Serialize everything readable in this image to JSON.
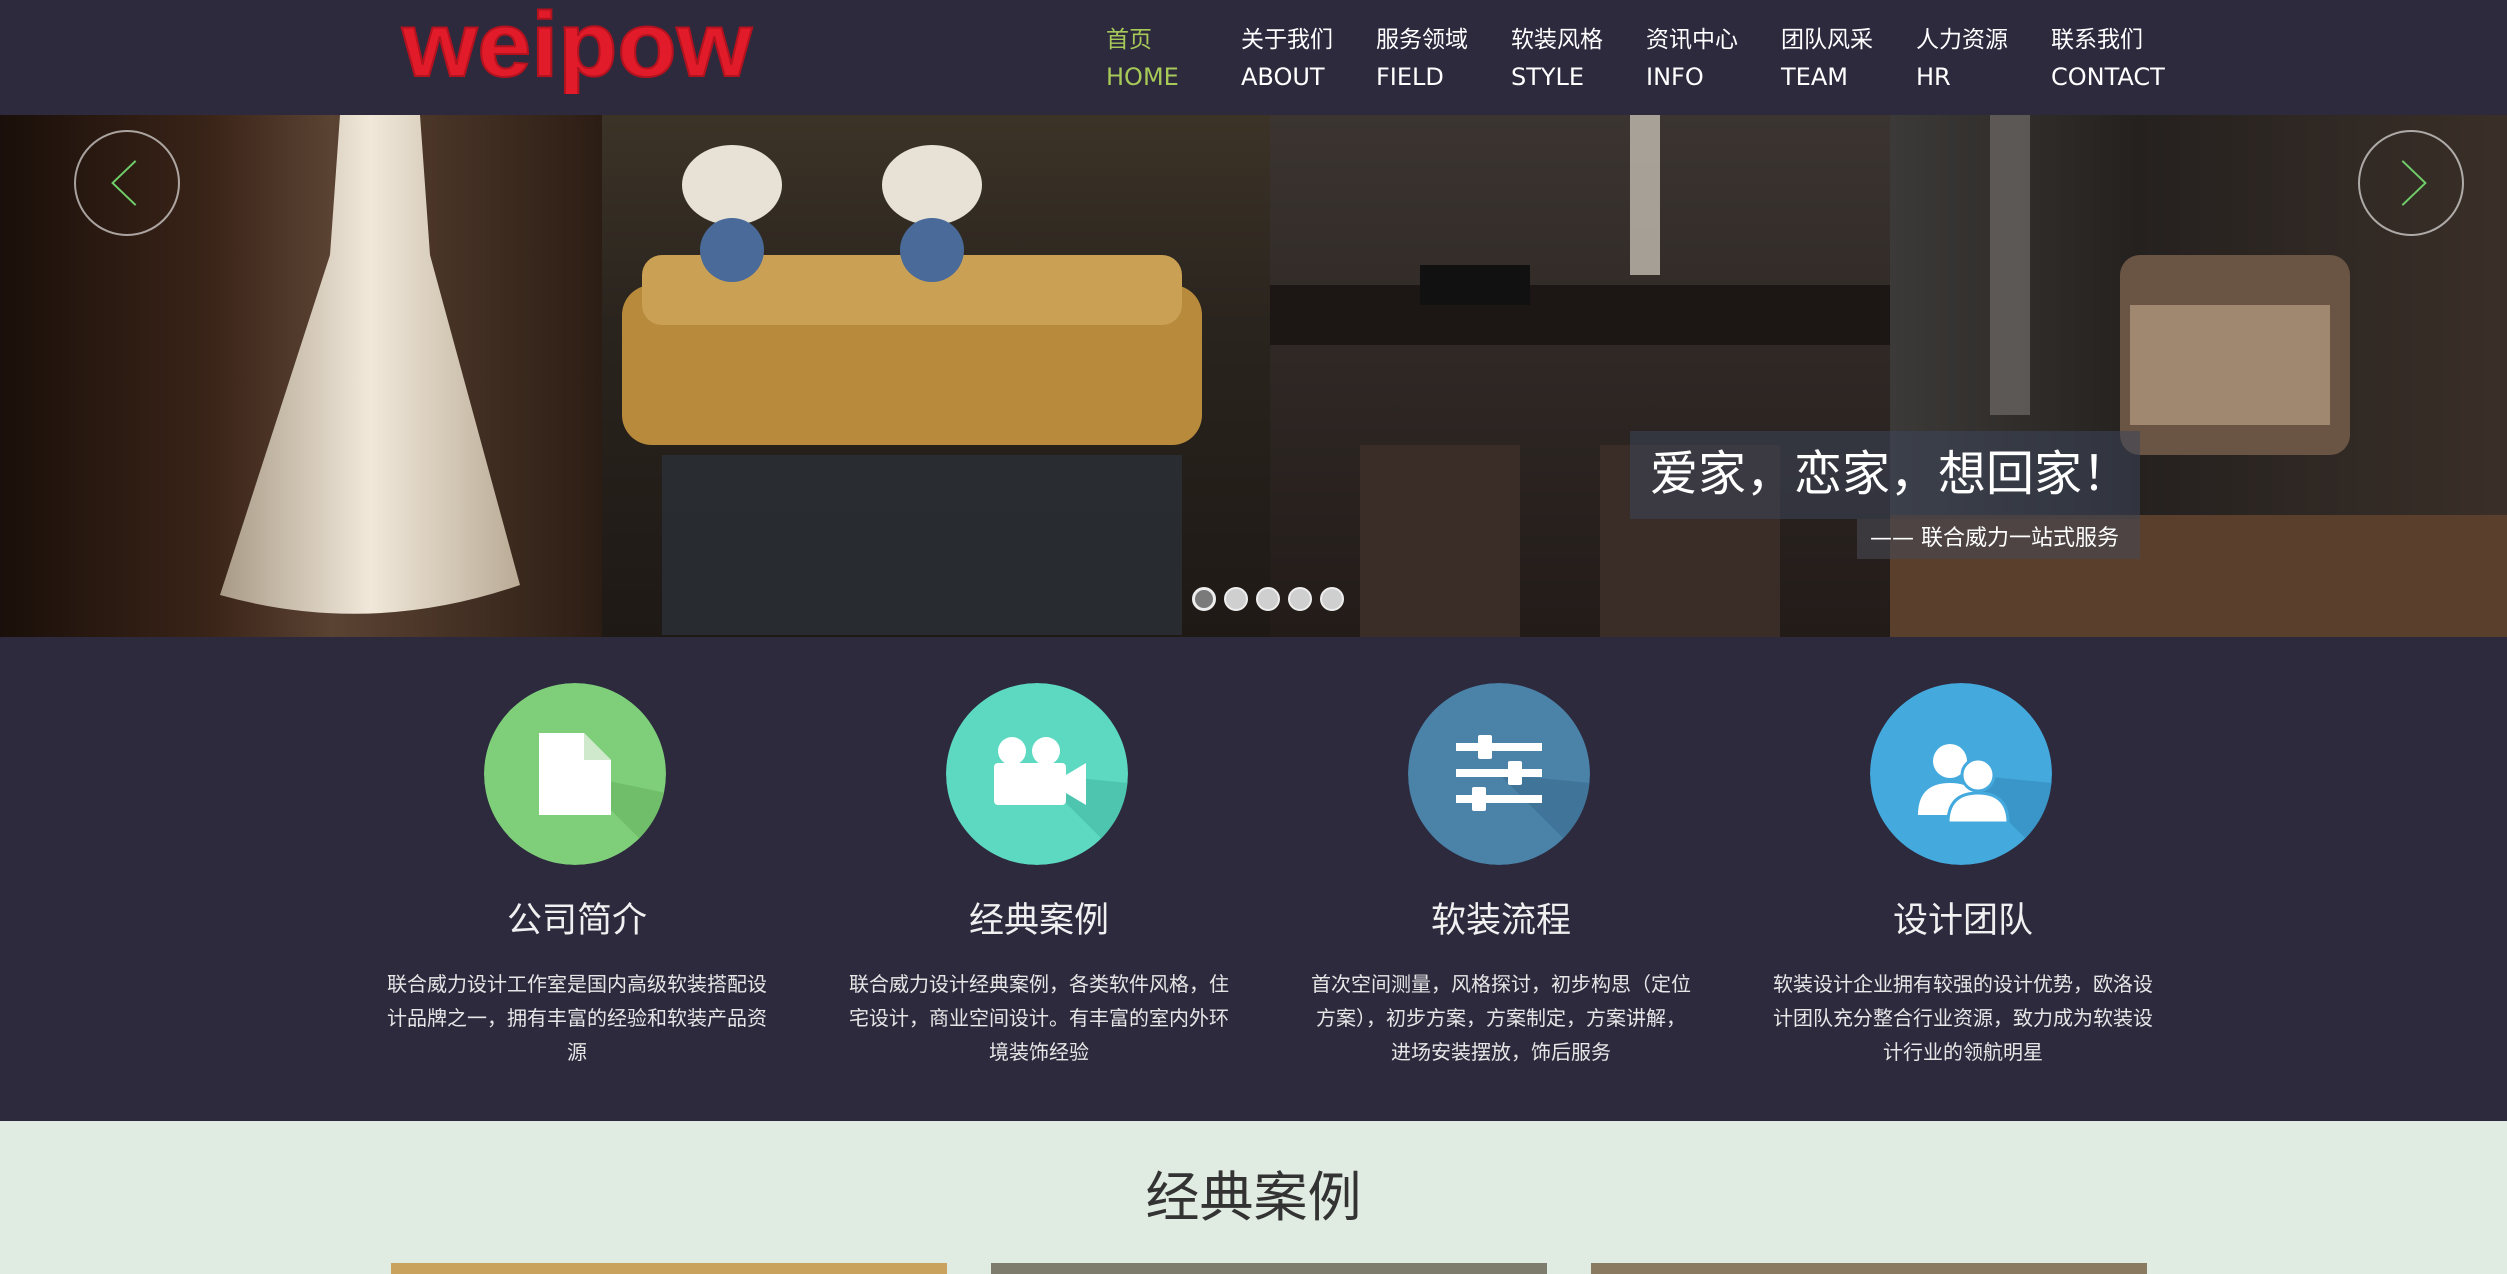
{
  "brand": {
    "logo_text": "weipow"
  },
  "nav": {
    "items": [
      {
        "cn": "首页",
        "en": "HOME",
        "active": true
      },
      {
        "cn": "关于我们",
        "en": "ABOUT"
      },
      {
        "cn": "服务领域",
        "en": "FIELD"
      },
      {
        "cn": "软装风格",
        "en": "STYLE"
      },
      {
        "cn": "资讯中心",
        "en": "INFO"
      },
      {
        "cn": "团队风采",
        "en": "TEAM"
      },
      {
        "cn": "人力资源",
        "en": "HR"
      },
      {
        "cn": "联系我们",
        "en": "CONTACT"
      }
    ]
  },
  "banner": {
    "title": "爱家，恋家，想回家！",
    "subtitle": "—— 联合威力一站式服务",
    "slide_count": 5,
    "active_slide": 1
  },
  "services": [
    {
      "icon": "document-icon",
      "color": "#7fcf7a",
      "title": "公司简介",
      "desc": "联合威力设计工作室是国内高级软装搭配设计品牌之一，拥有丰富的经验和软装产品资源"
    },
    {
      "icon": "video-camera-icon",
      "color": "#5cd9c0",
      "title": "经典案例",
      "desc": "联合威力设计经典案例，各类软件风格，住宅设计，商业空间设计。有丰富的室内外环境装饰经验"
    },
    {
      "icon": "sliders-icon",
      "color": "#4a82a8",
      "title": "软装流程",
      "desc": "首次空间测量，风格探讨，初步构思（定位方案），初步方案，方案制定，方案讲解，进场安装摆放，饰后服务"
    },
    {
      "icon": "users-icon",
      "color": "#44a9dd",
      "title": "设计团队",
      "desc": "软装设计企业拥有较强的设计优势，欧洛设计团队充分整合行业资源，致力成为软装设计行业的领航明星"
    }
  ],
  "cases": {
    "heading": "经典案例"
  },
  "colors": {
    "background": "#2d2a3e",
    "accent": "#a7c957",
    "logo_red": "#e21b2a",
    "cases_bg": "#e0ebe1"
  }
}
